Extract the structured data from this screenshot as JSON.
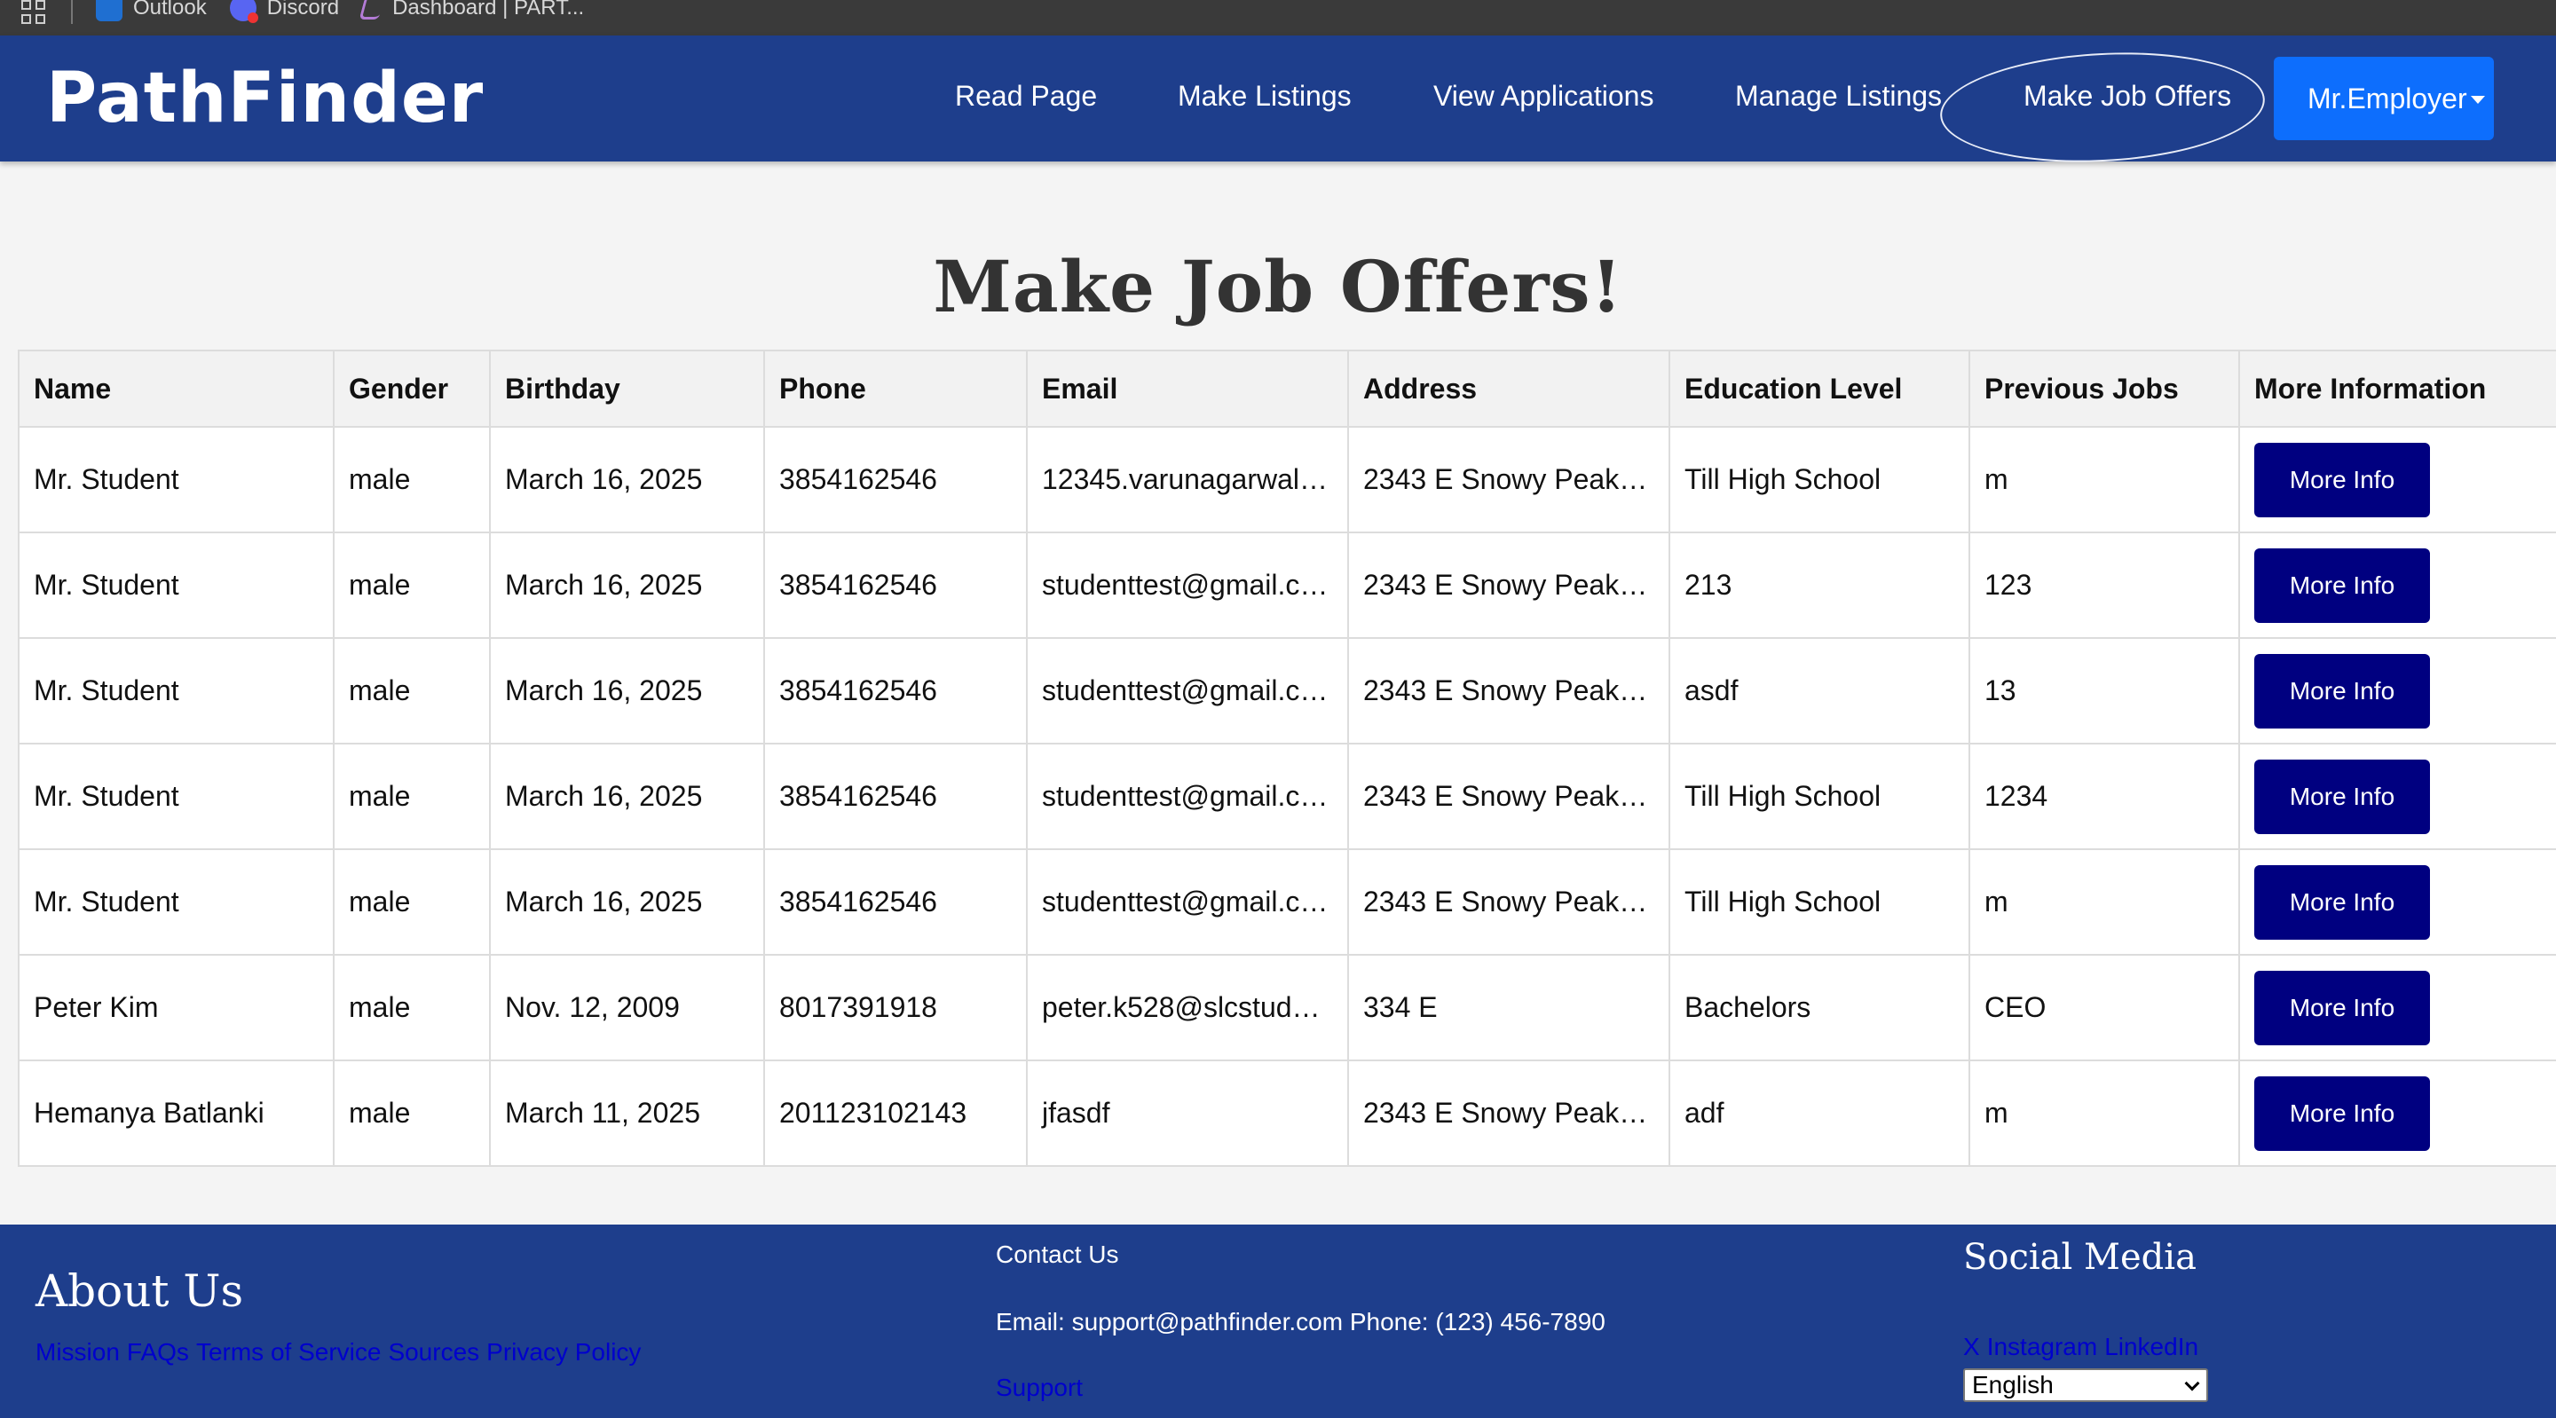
{
  "bookmarks": [
    {
      "label": "Outlook",
      "icon": "outlook-icon"
    },
    {
      "label": "Discord",
      "icon": "discord-icon"
    },
    {
      "label": "Dashboard | PART...",
      "icon": "dashboard-icon"
    }
  ],
  "nav": {
    "brand": "PathFinder",
    "links": [
      "Read Page",
      "Make Listings",
      "View Applications",
      "Manage Listings",
      "Make Job Offers"
    ],
    "user": "Mr.Employer"
  },
  "page": {
    "title": "Make Job Offers!"
  },
  "table": {
    "headers": [
      "Name",
      "Gender",
      "Birthday",
      "Phone",
      "Email",
      "Address",
      "Education Level",
      "Previous Jobs",
      "More Information"
    ],
    "button_label": "More Info",
    "rows": [
      [
        "Mr. Student",
        "male",
        "March 16, 2025",
        "3854162546",
        "12345.varunagarwal…",
        "2343 E Snowy Peak…",
        "Till High School",
        "m"
      ],
      [
        "Mr. Student",
        "male",
        "March 16, 2025",
        "3854162546",
        "studenttest@gmail.c…",
        "2343 E Snowy Peak…",
        "213",
        "123"
      ],
      [
        "Mr. Student",
        "male",
        "March 16, 2025",
        "3854162546",
        "studenttest@gmail.c…",
        "2343 E Snowy Peak…",
        "asdf",
        "13"
      ],
      [
        "Mr. Student",
        "male",
        "March 16, 2025",
        "3854162546",
        "studenttest@gmail.c…",
        "2343 E Snowy Peak…",
        "Till High School",
        "1234"
      ],
      [
        "Mr. Student",
        "male",
        "March 16, 2025",
        "3854162546",
        "studenttest@gmail.c…",
        "2343 E Snowy Peak…",
        "Till High School",
        "m"
      ],
      [
        "Peter Kim",
        "male",
        "Nov. 12, 2009",
        "8017391918",
        "peter.k528@slcstud…",
        "334 E",
        "Bachelors",
        "CEO"
      ],
      [
        "Hemanya Batlanki",
        "male",
        "March 11, 2025",
        "201123102143",
        "jfasdf",
        "2343 E Snowy Peak…",
        "adf",
        "m"
      ]
    ]
  },
  "footer": {
    "about_title": "About Us",
    "about_links": [
      "Mission",
      "FAQs",
      "Terms of Service",
      "Sources",
      "Privacy Policy"
    ],
    "contact_title": "Contact Us",
    "contact_line": "Email: support@pathfinder.com Phone: (123) 456-7890",
    "support_link": "Support",
    "social_title": "Social Media",
    "social_links": [
      "X",
      "Instagram",
      "LinkedIn"
    ],
    "language": "English"
  },
  "colors": {
    "navbar": "#1e3e8c",
    "primary_button": "#0d6efd",
    "more_info_button": "#000080",
    "link": "#0000cc"
  }
}
